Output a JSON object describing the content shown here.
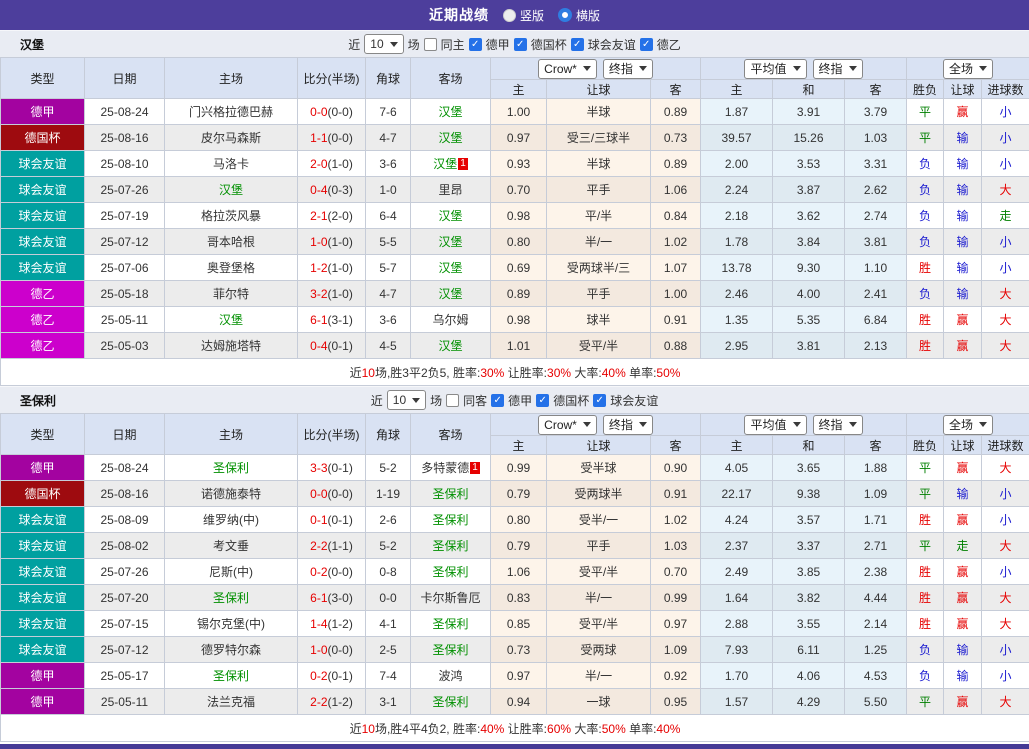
{
  "topbar": {
    "title": "近期战绩",
    "vertical_label": "竖版",
    "horizontal_label": "横版"
  },
  "headers": {
    "cols": [
      "类型",
      "日期",
      "主场",
      "比分(半场)",
      "角球",
      "客场"
    ],
    "subs": [
      "主",
      "让球",
      "客",
      "主",
      "和",
      "客",
      "胜负",
      "让球",
      "进球数"
    ],
    "dd_crow": "Crow*",
    "dd_final": "终指",
    "dd_avg": "平均值",
    "dd_full": "全场"
  },
  "filter": {
    "near": "近",
    "count": "10",
    "unit": "场"
  },
  "league_colors": {
    "德甲": "#a303a0",
    "德国杯": "#9e0b0f",
    "球会友谊": "#00a0a0",
    "德乙": "#cc00cc"
  },
  "outcome_colors": {
    "胜": "#e60000",
    "平": "#008000",
    "负": "#1a1ad0",
    "赢": "#e60000",
    "输": "#1a1ad0",
    "走": "#008000",
    "大": "#e60000",
    "小": "#1a1ad0"
  },
  "sections": [
    {
      "team": "汉堡",
      "same_label": "同主",
      "leagues": [
        "德甲",
        "德国杯",
        "球会友谊",
        "德乙"
      ],
      "rows": [
        {
          "league": "德甲",
          "date": "25-08-24",
          "home": "门兴格拉德巴赫",
          "home_self": false,
          "home_card": "",
          "score": "0-0",
          "half": "(0-0)",
          "corners": "7-6",
          "away": "汉堡",
          "away_self": true,
          "away_card": "",
          "odds": [
            "1.00",
            "半球",
            "0.89"
          ],
          "avg": [
            "1.87",
            "3.91",
            "3.79"
          ],
          "out": [
            "平",
            "赢",
            "小"
          ]
        },
        {
          "league": "德国杯",
          "date": "25-08-16",
          "home": "皮尔马森斯",
          "home_self": false,
          "home_card": "",
          "score": "1-1",
          "half": "(0-0)",
          "corners": "4-7",
          "away": "汉堡",
          "away_self": true,
          "away_card": "",
          "odds": [
            "0.97",
            "受三/三球半",
            "0.73"
          ],
          "avg": [
            "39.57",
            "15.26",
            "1.03"
          ],
          "out": [
            "平",
            "输",
            "小"
          ]
        },
        {
          "league": "球会友谊",
          "date": "25-08-10",
          "home": "马洛卡",
          "home_self": false,
          "home_card": "",
          "score": "2-0",
          "half": "(1-0)",
          "corners": "3-6",
          "away": "汉堡",
          "away_self": true,
          "away_card": "1",
          "odds": [
            "0.93",
            "半球",
            "0.89"
          ],
          "avg": [
            "2.00",
            "3.53",
            "3.31"
          ],
          "out": [
            "负",
            "输",
            "小"
          ]
        },
        {
          "league": "球会友谊",
          "date": "25-07-26",
          "home": "汉堡",
          "home_self": true,
          "home_card": "",
          "score": "0-4",
          "half": "(0-3)",
          "corners": "1-0",
          "away": "里昂",
          "away_self": false,
          "away_card": "",
          "odds": [
            "0.70",
            "平手",
            "1.06"
          ],
          "avg": [
            "2.24",
            "3.87",
            "2.62"
          ],
          "out": [
            "负",
            "输",
            "大"
          ]
        },
        {
          "league": "球会友谊",
          "date": "25-07-19",
          "home": "格拉茨风暴",
          "home_self": false,
          "home_card": "",
          "score": "2-1",
          "half": "(2-0)",
          "corners": "6-4",
          "away": "汉堡",
          "away_self": true,
          "away_card": "",
          "odds": [
            "0.98",
            "平/半",
            "0.84"
          ],
          "avg": [
            "2.18",
            "3.62",
            "2.74"
          ],
          "out": [
            "负",
            "输",
            "走"
          ]
        },
        {
          "league": "球会友谊",
          "date": "25-07-12",
          "home": "哥本哈根",
          "home_self": false,
          "home_card": "",
          "score": "1-0",
          "half": "(1-0)",
          "corners": "5-5",
          "away": "汉堡",
          "away_self": true,
          "away_card": "",
          "odds": [
            "0.80",
            "半/一",
            "1.02"
          ],
          "avg": [
            "1.78",
            "3.84",
            "3.81"
          ],
          "out": [
            "负",
            "输",
            "小"
          ]
        },
        {
          "league": "球会友谊",
          "date": "25-07-06",
          "home": "奥登堡格",
          "home_self": false,
          "home_card": "",
          "score": "1-2",
          "half": "(1-0)",
          "corners": "5-7",
          "away": "汉堡",
          "away_self": true,
          "away_card": "",
          "odds": [
            "0.69",
            "受两球半/三",
            "1.07"
          ],
          "avg": [
            "13.78",
            "9.30",
            "1.10"
          ],
          "out": [
            "胜",
            "输",
            "小"
          ]
        },
        {
          "league": "德乙",
          "date": "25-05-18",
          "home": "菲尔特",
          "home_self": false,
          "home_card": "",
          "score": "3-2",
          "half": "(1-0)",
          "corners": "4-7",
          "away": "汉堡",
          "away_self": true,
          "away_card": "",
          "odds": [
            "0.89",
            "平手",
            "1.00"
          ],
          "avg": [
            "2.46",
            "4.00",
            "2.41"
          ],
          "out": [
            "负",
            "输",
            "大"
          ]
        },
        {
          "league": "德乙",
          "date": "25-05-11",
          "home": "汉堡",
          "home_self": true,
          "home_card": "",
          "score": "6-1",
          "half": "(3-1)",
          "corners": "3-6",
          "away": "乌尔姆",
          "away_self": false,
          "away_card": "",
          "odds": [
            "0.98",
            "球半",
            "0.91"
          ],
          "avg": [
            "1.35",
            "5.35",
            "6.84"
          ],
          "out": [
            "胜",
            "赢",
            "大"
          ]
        },
        {
          "league": "德乙",
          "date": "25-05-03",
          "home": "达姆施塔特",
          "home_self": false,
          "home_card": "",
          "score": "0-4",
          "half": "(0-1)",
          "corners": "4-5",
          "away": "汉堡",
          "away_self": true,
          "away_card": "",
          "odds": [
            "1.01",
            "受平/半",
            "0.88"
          ],
          "avg": [
            "2.95",
            "3.81",
            "2.13"
          ],
          "out": [
            "胜",
            "赢",
            "大"
          ]
        }
      ],
      "summary": [
        {
          "t": "近",
          "r": false
        },
        {
          "t": "10",
          "r": true
        },
        {
          "t": "场,胜3平2负5, 胜率:",
          "r": false
        },
        {
          "t": "30%",
          "r": true
        },
        {
          "t": " 让胜率:",
          "r": false
        },
        {
          "t": "30%",
          "r": true
        },
        {
          "t": " 大率:",
          "r": false
        },
        {
          "t": "40%",
          "r": true
        },
        {
          "t": " 单率:",
          "r": false
        },
        {
          "t": "50%",
          "r": true
        }
      ]
    },
    {
      "team": "圣保利",
      "same_label": "同客",
      "leagues": [
        "德甲",
        "德国杯",
        "球会友谊"
      ],
      "rows": [
        {
          "league": "德甲",
          "date": "25-08-24",
          "home": "圣保利",
          "home_self": true,
          "home_card": "",
          "score": "3-3",
          "half": "(0-1)",
          "corners": "5-2",
          "away": "多特蒙德",
          "away_self": false,
          "away_card": "1",
          "odds": [
            "0.99",
            "受半球",
            "0.90"
          ],
          "avg": [
            "4.05",
            "3.65",
            "1.88"
          ],
          "out": [
            "平",
            "赢",
            "大"
          ]
        },
        {
          "league": "德国杯",
          "date": "25-08-16",
          "home": "诺德施泰特",
          "home_self": false,
          "home_card": "",
          "score": "0-0",
          "half": "(0-0)",
          "corners": "1-19",
          "away": "圣保利",
          "away_self": true,
          "away_card": "",
          "odds": [
            "0.79",
            "受两球半",
            "0.91"
          ],
          "avg": [
            "22.17",
            "9.38",
            "1.09"
          ],
          "out": [
            "平",
            "输",
            "小"
          ]
        },
        {
          "league": "球会友谊",
          "date": "25-08-09",
          "home": "维罗纳(中)",
          "home_self": false,
          "home_card": "",
          "score": "0-1",
          "half": "(0-1)",
          "corners": "2-6",
          "away": "圣保利",
          "away_self": true,
          "away_card": "",
          "odds": [
            "0.80",
            "受半/一",
            "1.02"
          ],
          "avg": [
            "4.24",
            "3.57",
            "1.71"
          ],
          "out": [
            "胜",
            "赢",
            "小"
          ]
        },
        {
          "league": "球会友谊",
          "date": "25-08-02",
          "home": "考文垂",
          "home_self": false,
          "home_card": "",
          "score": "2-2",
          "half": "(1-1)",
          "corners": "5-2",
          "away": "圣保利",
          "away_self": true,
          "away_card": "",
          "odds": [
            "0.79",
            "平手",
            "1.03"
          ],
          "avg": [
            "2.37",
            "3.37",
            "2.71"
          ],
          "out": [
            "平",
            "走",
            "大"
          ]
        },
        {
          "league": "球会友谊",
          "date": "25-07-26",
          "home": "尼斯(中)",
          "home_self": false,
          "home_card": "",
          "score": "0-2",
          "half": "(0-0)",
          "corners": "0-8",
          "away": "圣保利",
          "away_self": true,
          "away_card": "",
          "odds": [
            "1.06",
            "受平/半",
            "0.70"
          ],
          "avg": [
            "2.49",
            "3.85",
            "2.38"
          ],
          "out": [
            "胜",
            "赢",
            "小"
          ]
        },
        {
          "league": "球会友谊",
          "date": "25-07-20",
          "home": "圣保利",
          "home_self": true,
          "home_card": "",
          "score": "6-1",
          "half": "(3-0)",
          "corners": "0-0",
          "away": "卡尔斯鲁厄",
          "away_self": false,
          "away_card": "",
          "odds": [
            "0.83",
            "半/一",
            "0.99"
          ],
          "avg": [
            "1.64",
            "3.82",
            "4.44"
          ],
          "out": [
            "胜",
            "赢",
            "大"
          ]
        },
        {
          "league": "球会友谊",
          "date": "25-07-15",
          "home": "锡尔克堡(中)",
          "home_self": false,
          "home_card": "",
          "score": "1-4",
          "half": "(1-2)",
          "corners": "4-1",
          "away": "圣保利",
          "away_self": true,
          "away_card": "",
          "odds": [
            "0.85",
            "受平/半",
            "0.97"
          ],
          "avg": [
            "2.88",
            "3.55",
            "2.14"
          ],
          "out": [
            "胜",
            "赢",
            "大"
          ]
        },
        {
          "league": "球会友谊",
          "date": "25-07-12",
          "home": "德罗特尔森",
          "home_self": false,
          "home_card": "",
          "score": "1-0",
          "half": "(0-0)",
          "corners": "2-5",
          "away": "圣保利",
          "away_self": true,
          "away_card": "",
          "odds": [
            "0.73",
            "受两球",
            "1.09"
          ],
          "avg": [
            "7.93",
            "6.11",
            "1.25"
          ],
          "out": [
            "负",
            "输",
            "小"
          ]
        },
        {
          "league": "德甲",
          "date": "25-05-17",
          "home": "圣保利",
          "home_self": true,
          "home_card": "",
          "score": "0-2",
          "half": "(0-1)",
          "corners": "7-4",
          "away": "波鸿",
          "away_self": false,
          "away_card": "",
          "odds": [
            "0.97",
            "半/一",
            "0.92"
          ],
          "avg": [
            "1.70",
            "4.06",
            "4.53"
          ],
          "out": [
            "负",
            "输",
            "小"
          ]
        },
        {
          "league": "德甲",
          "date": "25-05-11",
          "home": "法兰克福",
          "home_self": false,
          "home_card": "",
          "score": "2-2",
          "half": "(1-2)",
          "corners": "3-1",
          "away": "圣保利",
          "away_self": true,
          "away_card": "",
          "odds": [
            "0.94",
            "一球",
            "0.95"
          ],
          "avg": [
            "1.57",
            "4.29",
            "5.50"
          ],
          "out": [
            "平",
            "赢",
            "大"
          ]
        }
      ],
      "summary": [
        {
          "t": "近",
          "r": false
        },
        {
          "t": "10",
          "r": true
        },
        {
          "t": "场,胜4平4负2, 胜率:",
          "r": false
        },
        {
          "t": "40%",
          "r": true
        },
        {
          "t": " 让胜率:",
          "r": false
        },
        {
          "t": "60%",
          "r": true
        },
        {
          "t": " 大率:",
          "r": false
        },
        {
          "t": "50%",
          "r": true
        },
        {
          "t": " 单率:",
          "r": false
        },
        {
          "t": "40%",
          "r": true
        }
      ]
    }
  ]
}
